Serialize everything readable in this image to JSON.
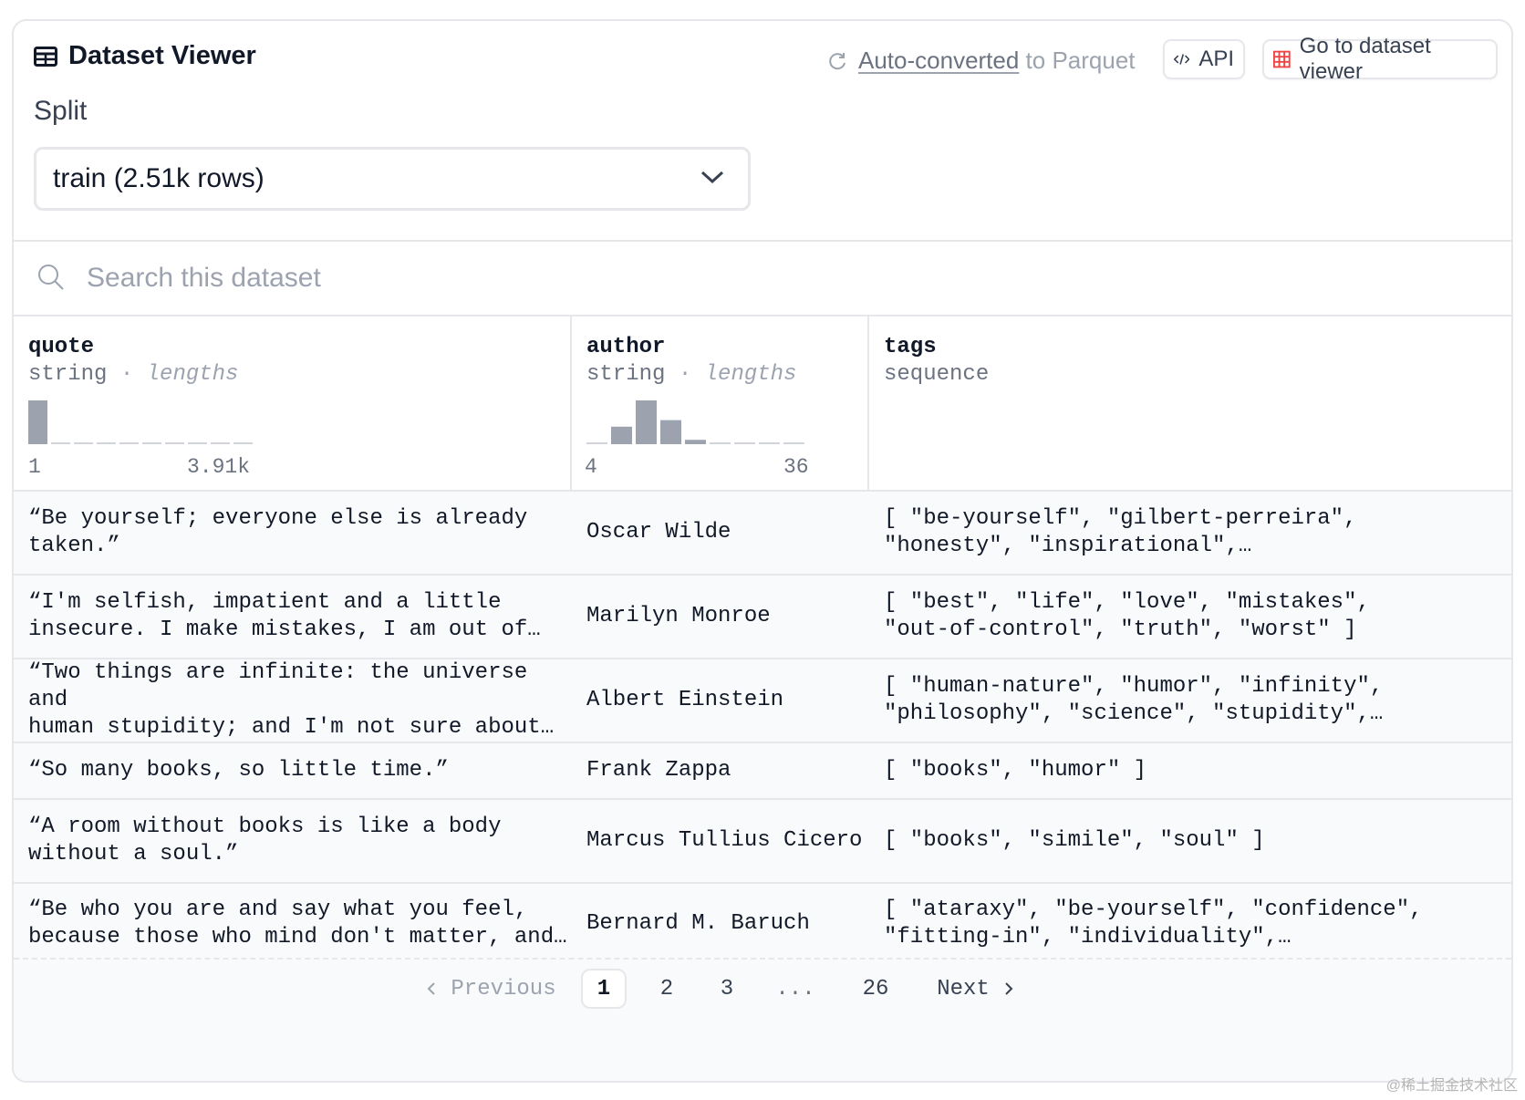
{
  "header": {
    "title": "Dataset Viewer",
    "converted_link": "Auto-converted",
    "converted_suffix": " to Parquet",
    "api_label": "API",
    "viewer_label": "Go to dataset viewer"
  },
  "split": {
    "label": "Split",
    "selected": "train (2.51k rows)"
  },
  "search": {
    "placeholder": "Search this dataset"
  },
  "columns": [
    {
      "name": "quote",
      "type": "string",
      "stat": "lengths",
      "min": "1",
      "max": "3.91k",
      "histogram": [
        1.0,
        0.04,
        0.04,
        0.04,
        0,
        0.04,
        0.04,
        0.04,
        0,
        0.04
      ]
    },
    {
      "name": "author",
      "type": "string",
      "stat": "lengths",
      "min": "4",
      "max": "36",
      "histogram": [
        0.04,
        0.4,
        1.0,
        0.55,
        0.1,
        0.04,
        0.04,
        0.04,
        0.04
      ]
    },
    {
      "name": "tags",
      "type": "sequence"
    }
  ],
  "rows": [
    {
      "quote": "“Be yourself; everyone else is already\ntaken.”",
      "author": "Oscar Wilde",
      "tags": "[ \"be-yourself\", \"gilbert-perreira\",\n\"honesty\", \"inspirational\",…"
    },
    {
      "quote": "“I'm selfish, impatient and a little\ninsecure. I make mistakes, I am out of…",
      "author": "Marilyn Monroe",
      "tags": "[ \"best\", \"life\", \"love\", \"mistakes\",\n\"out-of-control\", \"truth\", \"worst\" ]"
    },
    {
      "quote": "“Two things are infinite: the universe and\nhuman stupidity; and I'm not sure about…",
      "author": "Albert Einstein",
      "tags": "[ \"human-nature\", \"humor\", \"infinity\",\n\"philosophy\", \"science\", \"stupidity\",…"
    },
    {
      "quote": "“So many books, so little time.”",
      "author": "Frank Zappa",
      "tags": "[ \"books\", \"humor\" ]"
    },
    {
      "quote": "“A room without books is like a body\nwithout a soul.”",
      "author": "Marcus Tullius Cicero",
      "tags": "[ \"books\", \"simile\", \"soul\" ]"
    },
    {
      "quote": "“Be who you are and say what you feel,\nbecause those who mind don't matter, and…",
      "author": "Bernard M. Baruch",
      "tags": "[ \"ataraxy\", \"be-yourself\", \"confidence\",\n\"fitting-in\", \"individuality\",…"
    }
  ],
  "pagination": {
    "previous": "Previous",
    "pages": [
      "1",
      "2",
      "3",
      "...",
      "26"
    ],
    "current": "1",
    "next": "Next"
  },
  "watermark": "@稀土掘金技术社区",
  "colors": {
    "bar": "#9ca3af",
    "baseline": "#d1d5db",
    "border": "#e5e7eb",
    "row_bg": "#f9fafb"
  }
}
